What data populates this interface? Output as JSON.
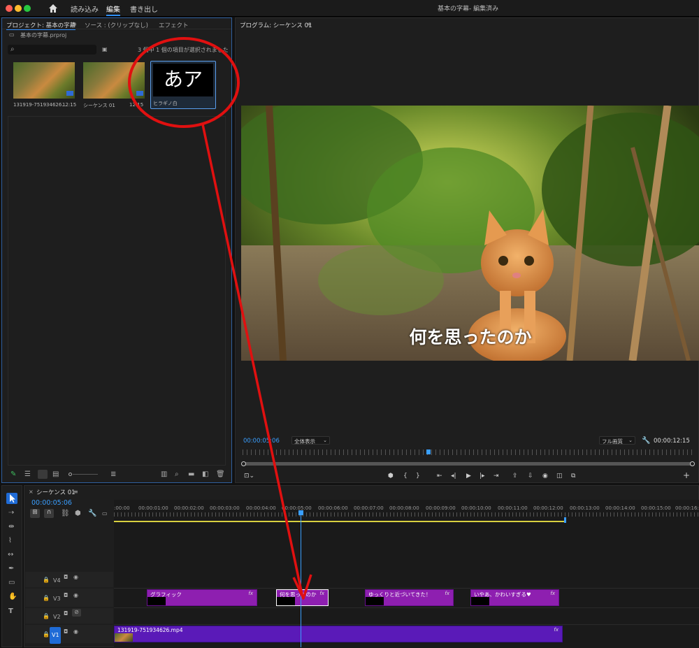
{
  "menu": {
    "home_icon": "home-icon",
    "import": "読み込み",
    "edit": "編集",
    "export": "書き出し",
    "window_title": "基本の字幕- 編集済み"
  },
  "project": {
    "tab_project": "プロジェクト: 基本の字幕",
    "tab_source": "ソース : (クリップなし)",
    "tab_effects": "エフェクト",
    "file": "基本の字幕.prproj",
    "selection_status": "3 個中 1 個の項目が選択されました",
    "items": [
      {
        "name": "131919-751934626...",
        "duration": "12:15"
      },
      {
        "name": "シーケンス 01",
        "duration": "12:15"
      },
      {
        "name": "ヒラギノ白",
        "preview_text": "あア"
      }
    ]
  },
  "program": {
    "tab": "プログラム: シーケンス 01",
    "subtitle": "何を思ったのか",
    "timecode": "00:00:05:06",
    "fit": "全体表示",
    "quality": "フル画質",
    "duration": "00:00:12:15"
  },
  "timeline": {
    "tab": "シーケンス 01",
    "timecode": "00:00:05:06",
    "ruler": [
      ":00:00",
      "00:00:01:00",
      "00:00:02:00",
      "00:00:03:00",
      "00:00:04:00",
      "00:00:05:00",
      "00:00:06:00",
      "00:00:07:00",
      "00:00:08:00",
      "00:00:09:00",
      "00:00:10:00",
      "00:00:11:00",
      "00:00:12:00",
      "00:00:13:00",
      "00:00:14:00",
      "00:00:15:00",
      "00:00:16:00"
    ],
    "tracks": [
      "V4",
      "V3",
      "V2",
      "V1"
    ],
    "clips": [
      {
        "label": "グラフィック",
        "fx": "fx"
      },
      {
        "label": "何を思ったのか",
        "fx": "fx"
      },
      {
        "label": "ゆっくりと近づいてきた！",
        "fx": "fx"
      },
      {
        "label": "いやあ、かわいすぎる♥",
        "fx": "fx"
      }
    ],
    "video_clip": {
      "label": "131919-751934626.mp4",
      "fx": "fx"
    }
  },
  "colors": {
    "accent": "#2f8fff",
    "clip": "#8e1fb0",
    "video_clip": "#5a1ab8",
    "annotation": "#e01010",
    "track_selected": "#1f6bd6"
  }
}
